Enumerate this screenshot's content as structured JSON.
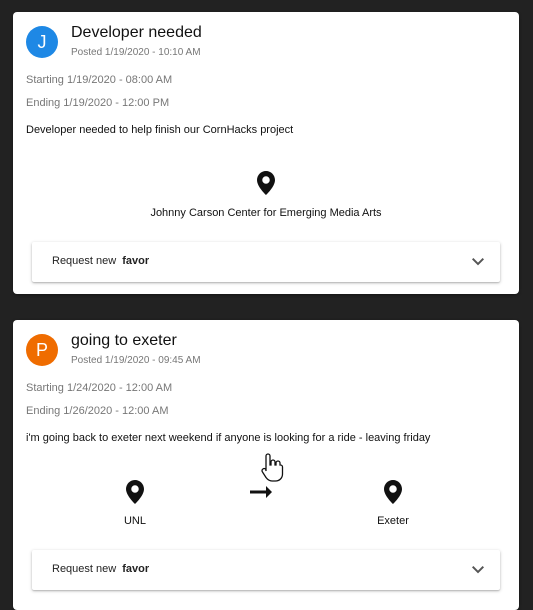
{
  "posts": [
    {
      "avatar_letter": "J",
      "avatar_color": "#1e88e5",
      "title": "Developer needed",
      "posted": "Posted 1/19/2020 - 10:10 AM",
      "starting": "Starting 1/19/2020 - 08:00 AM",
      "ending": "Ending 1/19/2020 - 12:00 PM",
      "description": "Developer needed to help finish our CornHacks project",
      "location": "Johnny Carson Center for Emerging Media Arts",
      "pin_icon": "location-pin-icon",
      "request_label": "Request new",
      "request_bold": "favor",
      "expand_icon": "chevron-down-icon"
    },
    {
      "avatar_letter": "P",
      "avatar_color": "#ef6c00",
      "title": "going to exeter",
      "posted": "Posted 1/19/2020 - 09:45 AM",
      "starting": "Starting 1/24/2020 - 12:00 AM",
      "ending": "Ending 1/26/2020 - 12:00 AM",
      "description": "i'm going back to exeter next weekend if anyone is looking for a ride - leaving friday",
      "origin": "UNL",
      "destination": "Exeter",
      "arrow_icon": "arrow-right-icon",
      "pin_icon": "location-pin-icon",
      "request_label": "Request new",
      "request_bold": "favor",
      "expand_icon": "chevron-down-icon"
    }
  ],
  "cursor_icon": "hand-pointer-cursor-icon"
}
